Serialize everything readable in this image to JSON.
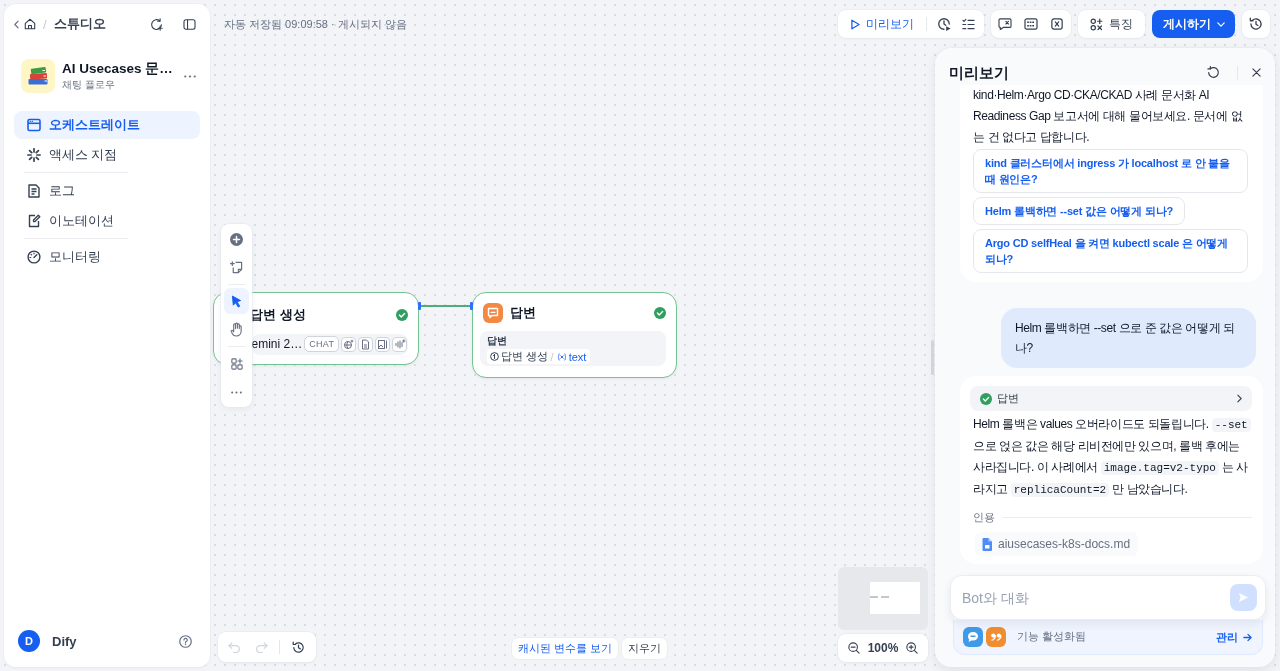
{
  "sidebar": {
    "breadcrumb": {
      "separator": "/",
      "current": "스튜디오"
    },
    "app": {
      "name": "AI Usecases 문…",
      "type": "채팅 플로우"
    },
    "nav_groups": [
      [
        {
          "label": "오케스트레이트",
          "selected": true
        },
        {
          "label": "액세스 지점",
          "selected": false
        }
      ],
      [
        {
          "label": "로그",
          "selected": false
        },
        {
          "label": "이노테이션",
          "selected": false
        }
      ],
      [
        {
          "label": "모니터링",
          "selected": false
        }
      ]
    ],
    "user": {
      "initial": "D",
      "name": "Dify"
    }
  },
  "top_bar": {
    "status": "자동 저장됨 09:09:58 · 게시되지 않음",
    "preview_button": "미리보기",
    "features_button": "특징",
    "publish_button": "게시하기"
  },
  "canvas": {
    "tools": [
      {
        "kind": "pointer",
        "selected": true
      },
      {
        "kind": "hand",
        "selected": false
      }
    ],
    "nodes": [
      {
        "kind": "llm",
        "title": "답변 생성",
        "completed": true,
        "model": "emini 2…",
        "mode_tag": "CHAT"
      },
      {
        "kind": "answer",
        "title": "답변",
        "completed": true,
        "field_label": "답변",
        "source_node": "답변 생성",
        "separator": "/",
        "variable": "text"
      }
    ],
    "history": {
      "undo_disabled": true,
      "redo_disabled": true
    },
    "cached_variables_button": "캐시된 변수를 보기",
    "clear_button": "지우기",
    "zoom": "100%"
  },
  "preview": {
    "title": "미리보기",
    "messages": [
      {
        "kind": "bot",
        "text": "kind·Helm·Argo CD·CKA/CKAD 사례 문서화 AI Readiness Gap 보고서에 대해 물어보세요. 문서에 없는 건 없다고 답합니다.",
        "suggestions": [
          "kind 클러스터에서 ingress 가 localhost 로 안 붙을 때 원인은?",
          "Helm 롤백하면 --set 값은 어떻게 되나?",
          "Argo CD selfHeal 을 켜면 kubectl scale 은 어떻게 되나?"
        ]
      },
      {
        "kind": "user",
        "text": "Helm 롤백하면 --set 으로 준 값은 어떻게 되나?"
      },
      {
        "kind": "bot",
        "workflow": {
          "label": "답변",
          "completed": true
        },
        "segments": [
          {
            "kind": "text",
            "text": "Helm 롤백은 values 오버라이드도 되돌립니다. "
          },
          {
            "kind": "code",
            "text": "--set"
          },
          {
            "kind": "text",
            "text": " 으로 얹은 값은 해당 리비전에만 있으며, 롤백 후에는 사라집니다. 이 사례에서 "
          },
          {
            "kind": "code",
            "text": "image.tag=v2-typo"
          },
          {
            "kind": "text",
            "text": " 는 사라지고 "
          },
          {
            "kind": "code",
            "text": "replicaCount=2"
          },
          {
            "kind": "text",
            "text": " 만 남았습니다."
          }
        ],
        "citation": {
          "label": "인용",
          "files": [
            "aiusecases-k8s-docs.md"
          ]
        }
      }
    ],
    "input": {
      "placeholder": "Bot와 대화",
      "send_disabled": true
    },
    "features": {
      "label": "기능 활성화됨",
      "link": "관리"
    }
  }
}
